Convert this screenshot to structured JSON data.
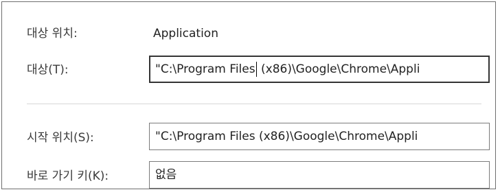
{
  "properties": {
    "target_type_label": "대상 위치:",
    "target_type_value": "Application",
    "target_label": "대상(T):",
    "target_value_before_caret": "\"C:\\Program Files",
    "target_value_after_caret": " (x86)\\Google\\Chrome\\Appli",
    "start_in_label": "시작 위치(S):",
    "start_in_value": "\"C:\\Program Files (x86)\\Google\\Chrome\\Appli",
    "shortcut_key_label": "바로 가기 키(K):",
    "shortcut_key_value": "없음"
  }
}
